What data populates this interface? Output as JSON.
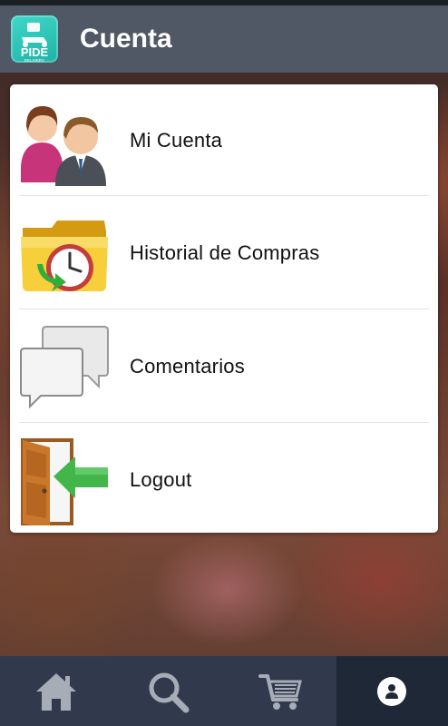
{
  "header": {
    "title": "Cuenta",
    "logo_text": "PIDE",
    "logo_subtext": "DELIVERY"
  },
  "menu": {
    "items": [
      {
        "label": "Mi Cuenta",
        "icon": "users-icon"
      },
      {
        "label": "Historial de Compras",
        "icon": "history-folder-icon"
      },
      {
        "label": "Comentarios",
        "icon": "chat-bubbles-icon"
      },
      {
        "label": "Logout",
        "icon": "logout-door-icon"
      }
    ]
  },
  "bottom_nav": {
    "tabs": [
      {
        "icon": "home-icon",
        "active": false
      },
      {
        "icon": "search-icon",
        "active": false
      },
      {
        "icon": "cart-icon",
        "active": false
      },
      {
        "icon": "account-icon",
        "active": true
      }
    ]
  },
  "colors": {
    "topbar": "#4f5864",
    "bottombar": "#303a4c",
    "bottombar_active": "#1f2836",
    "logo": "#1fb3a6"
  }
}
